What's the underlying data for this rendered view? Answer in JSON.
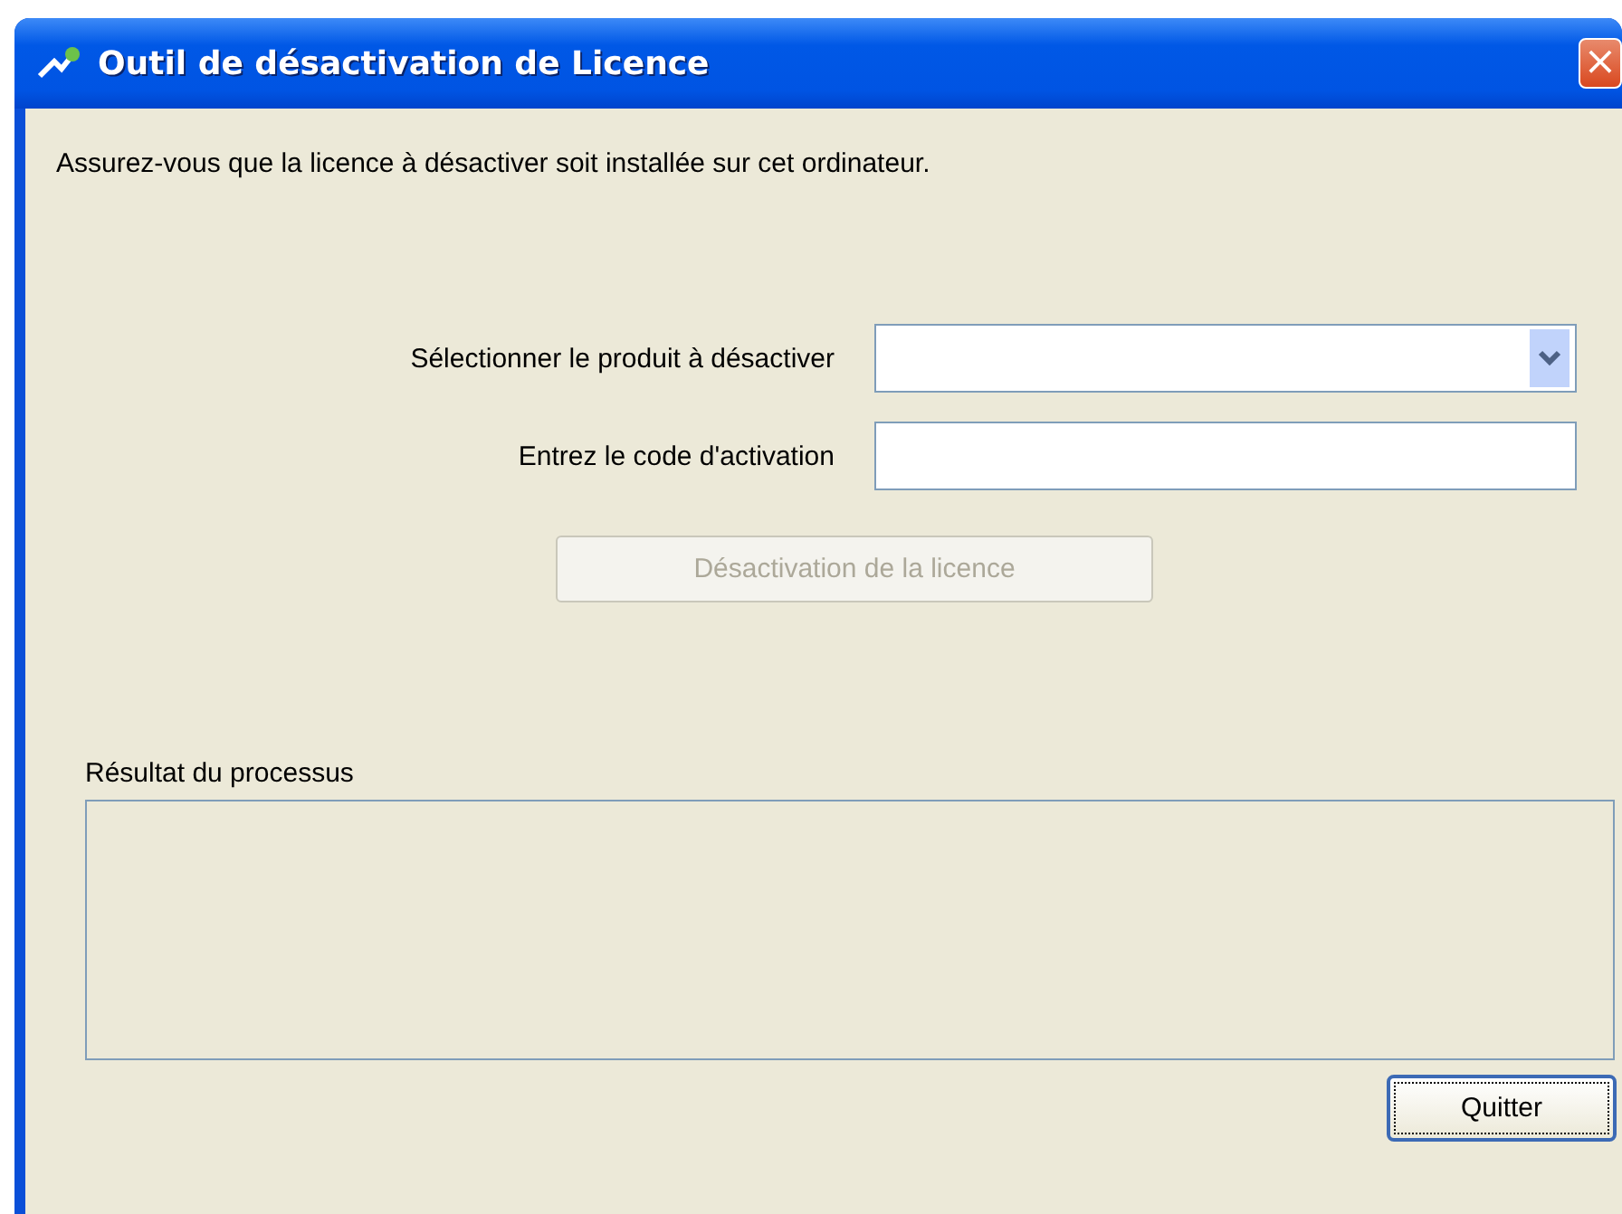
{
  "window": {
    "title": "Outil de désactivation de Licence",
    "close": "×"
  },
  "instruction": "Assurez-vous que la licence à désactiver soit installée sur cet ordinateur.",
  "form": {
    "product_label": "Sélectionner le produit à désactiver",
    "code_label": "Entrez le code d'activation",
    "deactivate_button": {
      "label": "Désactivation de la licence",
      "disabled": true
    }
  },
  "result": {
    "label": "Résultat du processus"
  },
  "quit_button": {
    "label": "Quitter"
  }
}
